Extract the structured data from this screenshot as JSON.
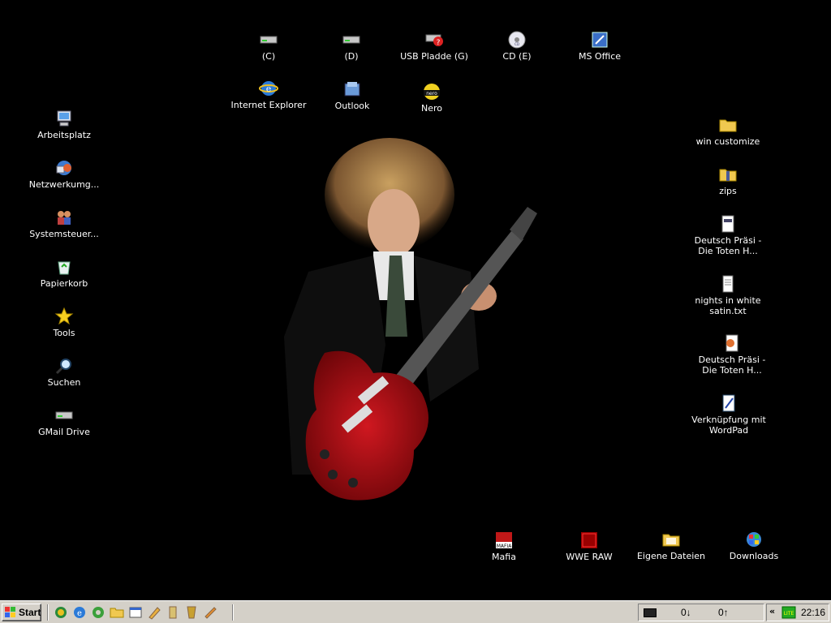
{
  "desktop": {
    "top_icons": [
      {
        "label": "(C)",
        "icon": "hard-drive-icon"
      },
      {
        "label": "(D)",
        "icon": "hard-drive-icon"
      },
      {
        "label": "USB Pladde (G)",
        "icon": "usb-drive-icon"
      },
      {
        "label": "CD (E)",
        "icon": "cd-drive-icon"
      },
      {
        "label": "MS Office",
        "icon": "ms-office-icon"
      },
      {
        "label": "Internet Explorer",
        "icon": "internet-explorer-icon"
      },
      {
        "label": "Outlook",
        "icon": "outlook-icon"
      },
      {
        "label": "Nero",
        "icon": "nero-icon"
      }
    ],
    "left_icons": [
      {
        "label": "Arbeitsplatz",
        "icon": "my-computer-icon"
      },
      {
        "label": "Netzwerkumg...",
        "icon": "network-places-icon"
      },
      {
        "label": "Systemsteuer...",
        "icon": "control-panel-icon"
      },
      {
        "label": "Papierkorb",
        "icon": "recycle-bin-icon"
      },
      {
        "label": "Tools",
        "icon": "star-icon"
      },
      {
        "label": "Suchen",
        "icon": "search-icon"
      },
      {
        "label": "GMail Drive",
        "icon": "drive-icon"
      }
    ],
    "right_icons": [
      {
        "label": "win customize",
        "icon": "folder-icon"
      },
      {
        "label": "zips",
        "icon": "zip-folder-icon"
      },
      {
        "label": "Deutsch Präsi - Die Toten H...",
        "icon": "document-icon"
      },
      {
        "label": "nights in white satin.txt",
        "icon": "text-file-icon"
      },
      {
        "label": "Deutsch Präsi - Die Toten H...",
        "icon": "powerpoint-file-icon"
      },
      {
        "label": "Verknüpfung mit WordPad",
        "icon": "wordpad-icon"
      }
    ],
    "bottom_icons": [
      {
        "label": "Mafia",
        "icon": "mafia-icon"
      },
      {
        "label": "WWE RAW",
        "icon": "wwe-raw-icon"
      },
      {
        "label": "Eigene Dateien",
        "icon": "folder-icon"
      },
      {
        "label": "Downloads",
        "icon": "downloads-icon"
      }
    ]
  },
  "taskbar": {
    "start_label": "Start",
    "quick_launch": [
      "browser-icon",
      "internet-explorer-icon",
      "gear-icon",
      "folder-icon",
      "explorer-icon",
      "pencil-icon",
      "tool-icon",
      "app-icon",
      "shortcut-icon"
    ],
    "net_down": "0↓",
    "net_up": "0↑",
    "tray_chevron": "«",
    "clock": "22:16"
  },
  "colors": {
    "desktop_bg": "#000000",
    "taskbar_bg": "#d4d0c8",
    "icon_label": "#ffffff"
  }
}
